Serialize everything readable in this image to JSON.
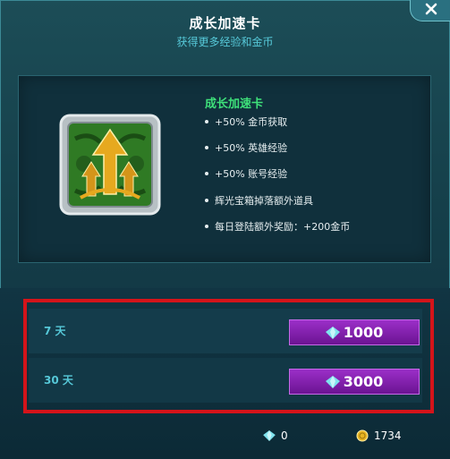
{
  "header": {
    "title": "成长加速卡",
    "subtitle": "获得更多经验和金币"
  },
  "card": {
    "name": "成长加速卡",
    "icon": "green-arrow-emblem-icon",
    "benefits": [
      "+50% 金币获取",
      "+50% 英雄经验",
      "+50% 账号经验",
      "辉光宝箱掉落额外道具",
      "每日登陆额外奖励：+200金币"
    ]
  },
  "options": [
    {
      "label": "7 天",
      "price": "1000",
      "currency_icon": "gem-icon"
    },
    {
      "label": "30 天",
      "price": "3000",
      "currency_icon": "gem-icon"
    }
  ],
  "footer": {
    "gem_balance": "0",
    "gold_balance": "1734"
  },
  "colors": {
    "card_name": "#3ee07a",
    "subtitle": "#56c8d8",
    "buy_button": "#8a22b8",
    "highlight": "#d4141a"
  }
}
